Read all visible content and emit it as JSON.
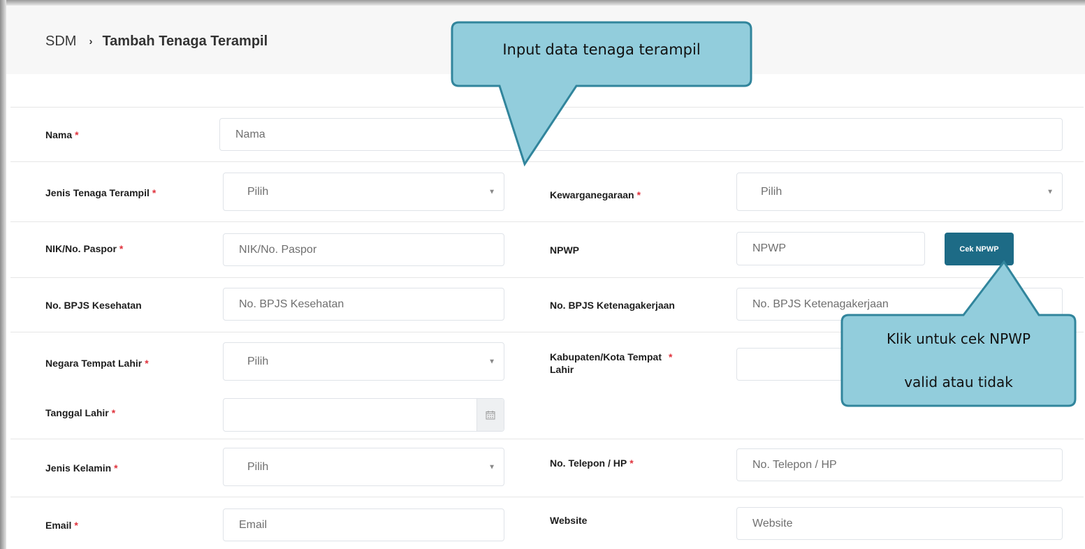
{
  "breadcrumb": {
    "root": "SDM",
    "separator": "›",
    "current": "Tambah Tenaga Terampil"
  },
  "required_marker": "*",
  "fields": {
    "nama": {
      "label": "Nama",
      "placeholder": "Nama"
    },
    "jenis_tenaga": {
      "label": "Jenis Tenaga Terampil",
      "value": "Pilih"
    },
    "kewarganegaraan": {
      "label": "Kewarganegaraan",
      "value": "Pilih"
    },
    "nik": {
      "label": "NIK/No. Paspor",
      "placeholder": "NIK/No. Paspor"
    },
    "npwp": {
      "label": "NPWP",
      "placeholder": "NPWP",
      "button": "Cek NPWP"
    },
    "bpjs_kes": {
      "label": "No. BPJS Kesehatan",
      "placeholder": "No. BPJS Kesehatan"
    },
    "bpjs_tk": {
      "label": "No. BPJS Ketenagakerjaan",
      "placeholder": "No. BPJS Ketenagakerjaan"
    },
    "negara_lahir": {
      "label": "Negara Tempat Lahir",
      "value": "Pilih"
    },
    "kota_lahir": {
      "label_line1": "Kabupaten/Kota Tempat",
      "label_line2": "Lahir"
    },
    "tanggal_lahir": {
      "label": "Tanggal Lahir",
      "value": ""
    },
    "jenis_kelamin": {
      "label": "Jenis Kelamin",
      "value": "Pilih"
    },
    "telepon": {
      "label": "No. Telepon / HP",
      "placeholder": "No. Telepon / HP"
    },
    "email": {
      "label": "Email",
      "placeholder": "Email"
    },
    "website": {
      "label": "Website",
      "placeholder": "Website"
    }
  },
  "callouts": {
    "input_data": "Input data tenaga terampil",
    "cek_npwp_line1": "Klik untuk cek NPWP",
    "cek_npwp_line2": "valid atau tidak"
  },
  "colors": {
    "accent": "#1d6b86",
    "callout_fill": "#92cddc",
    "callout_border": "#31859c",
    "required": "#e0323c"
  },
  "icons": {
    "breadcrumb_separator": "chevron-right-icon",
    "select_caret": "caret-down-icon",
    "date": "calendar-icon"
  }
}
